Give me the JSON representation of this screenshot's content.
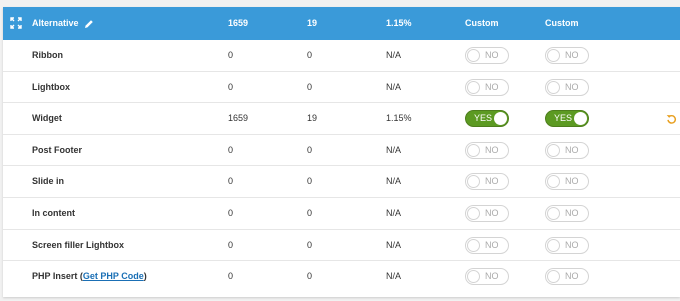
{
  "header": {
    "title": "Alternative",
    "views": "1659",
    "conversions": "19",
    "rate": "1.15%",
    "test1": "Custom",
    "test2": "Custom"
  },
  "rows": [
    {
      "label": "Ribbon",
      "views": "0",
      "conversions": "0",
      "rate": "N/A",
      "t1": "NO",
      "t2": "NO"
    },
    {
      "label": "Lightbox",
      "views": "0",
      "conversions": "0",
      "rate": "N/A",
      "t1": "NO",
      "t2": "NO"
    },
    {
      "label": "Widget",
      "views": "1659",
      "conversions": "19",
      "rate": "1.15%",
      "t1": "YES",
      "t2": "YES"
    },
    {
      "label": "Post Footer",
      "views": "0",
      "conversions": "0",
      "rate": "N/A",
      "t1": "NO",
      "t2": "NO"
    },
    {
      "label": "Slide in",
      "views": "0",
      "conversions": "0",
      "rate": "N/A",
      "t1": "NO",
      "t2": "NO"
    },
    {
      "label": "In content",
      "views": "0",
      "conversions": "0",
      "rate": "N/A",
      "t1": "NO",
      "t2": "NO"
    },
    {
      "label": "Screen filler Lightbox",
      "views": "0",
      "conversions": "0",
      "rate": "N/A",
      "t1": "NO",
      "t2": "NO"
    },
    {
      "label": "PHP Insert",
      "link": "Get PHP Code",
      "views": "0",
      "conversions": "0",
      "rate": "N/A",
      "t1": "NO",
      "t2": "NO"
    }
  ],
  "icons": {
    "expand": "expand-icon",
    "edit": "pencil-icon",
    "reset": "undo-icon"
  },
  "colors": {
    "header": "#3a9ad9",
    "toggle_on": "#5c9a22",
    "reset": "#e8a020",
    "link": "#1a6fb5"
  }
}
